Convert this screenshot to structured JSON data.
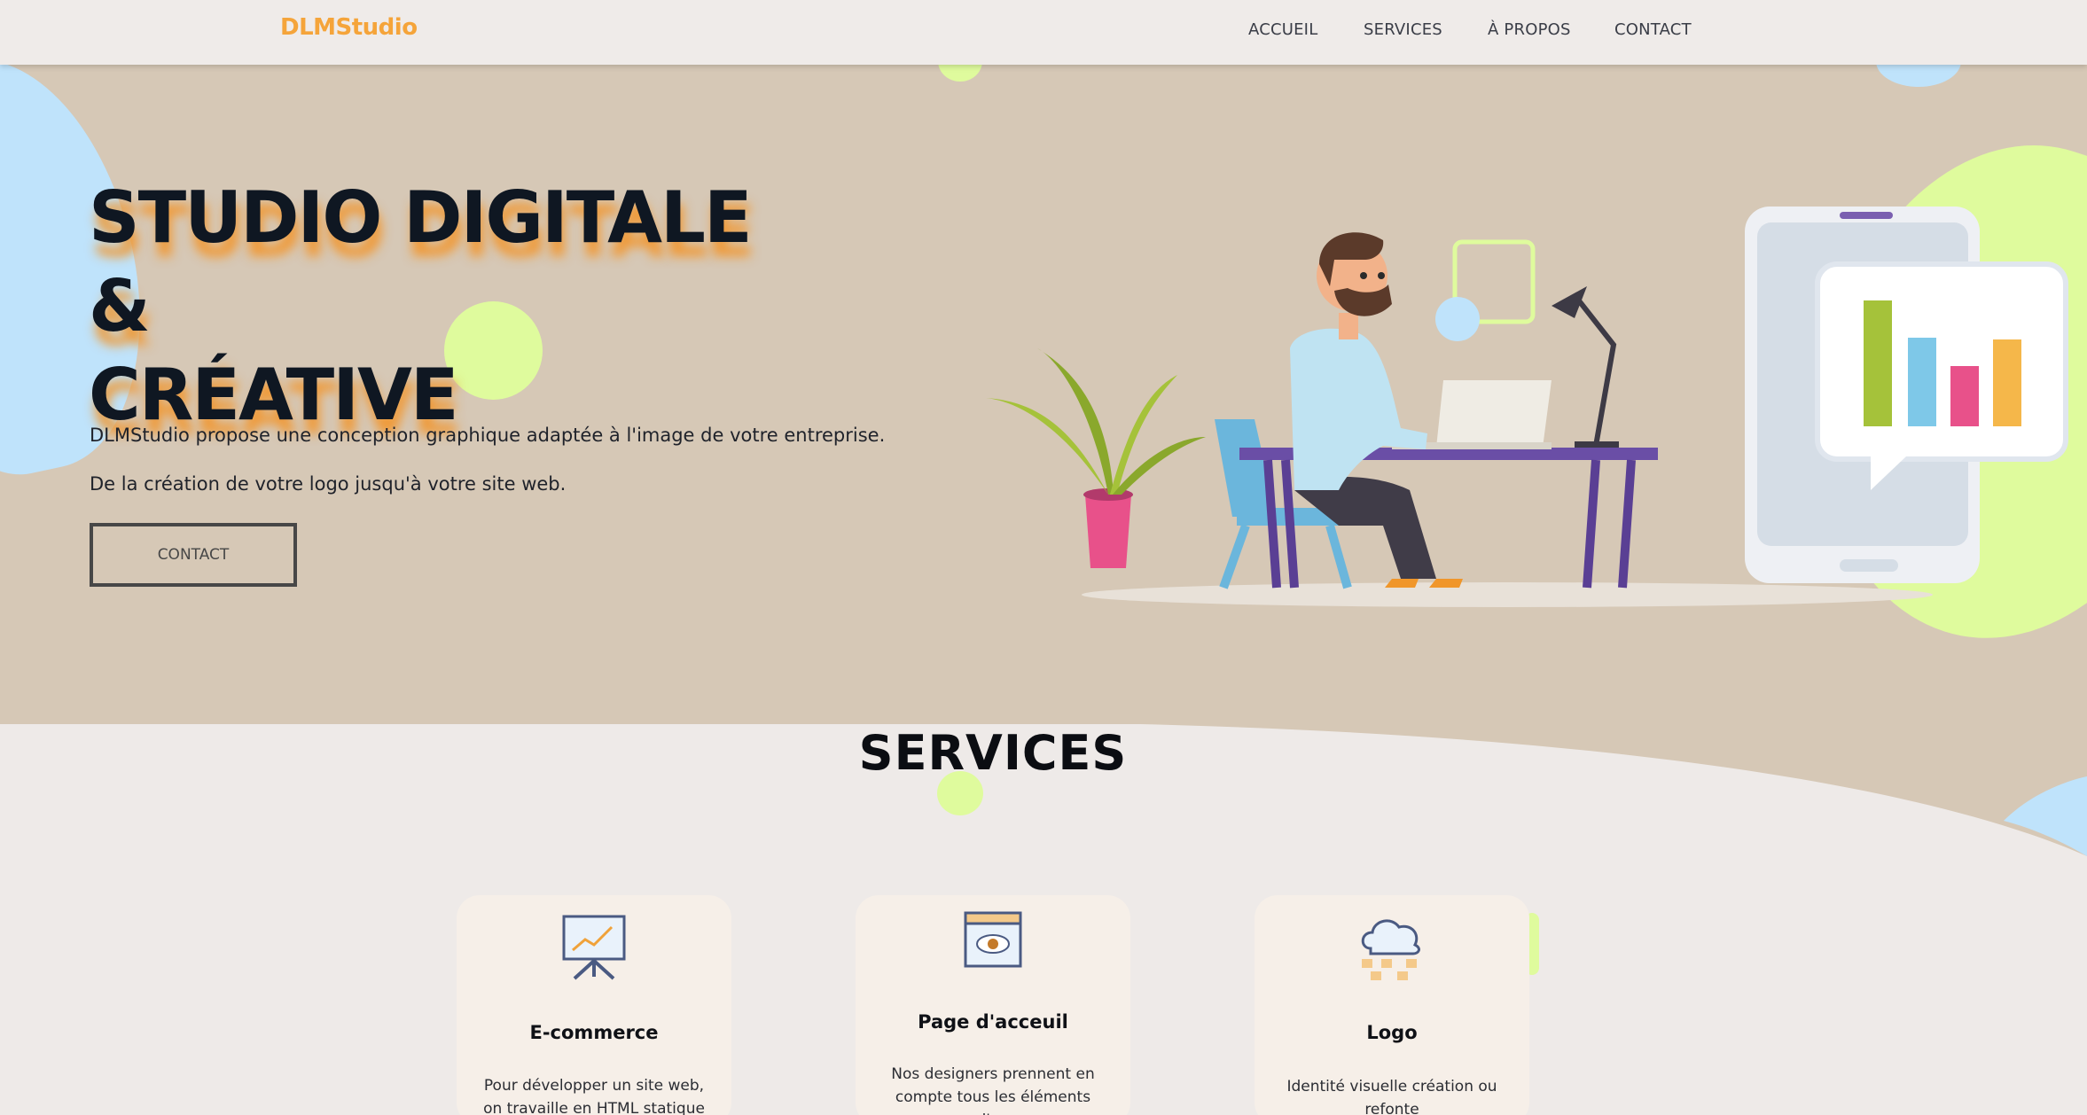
{
  "navbar": {
    "brand": "DLMStudio",
    "links": [
      "ACCUEIL",
      "SERVICES",
      "À PROPOS",
      "CONTACT"
    ]
  },
  "hero": {
    "title_line1": "STUDIO DIGITALE &",
    "title_line2": "CRÉATIVE",
    "paragraph1": "DLMStudio propose une conception graphique adaptée à l'image de votre entreprise.",
    "paragraph2": "De la création de votre logo jusqu'à votre site web.",
    "button_label": "CONTACT"
  },
  "services": {
    "title": "SERVICES",
    "cards": [
      {
        "icon": "presentation-chart-icon",
        "title": "E-commerce",
        "text": "Pour développer un site web, on travaille en HTML statique"
      },
      {
        "icon": "browser-eye-icon",
        "title": "Page d'acceuil",
        "text": "Nos designers prennent en compte tous les éléments d'un"
      },
      {
        "icon": "cloud-network-icon",
        "title": "Logo",
        "text": "Identité visuelle création ou refonte"
      }
    ]
  },
  "colors": {
    "brand": "#f5a43a",
    "hero_bg": "#d6c8b6",
    "page_bg": "#eeeae8",
    "accent_lime": "#dffb9d",
    "accent_blue": "#bfe3fb",
    "title_dark": "#0f1722"
  }
}
